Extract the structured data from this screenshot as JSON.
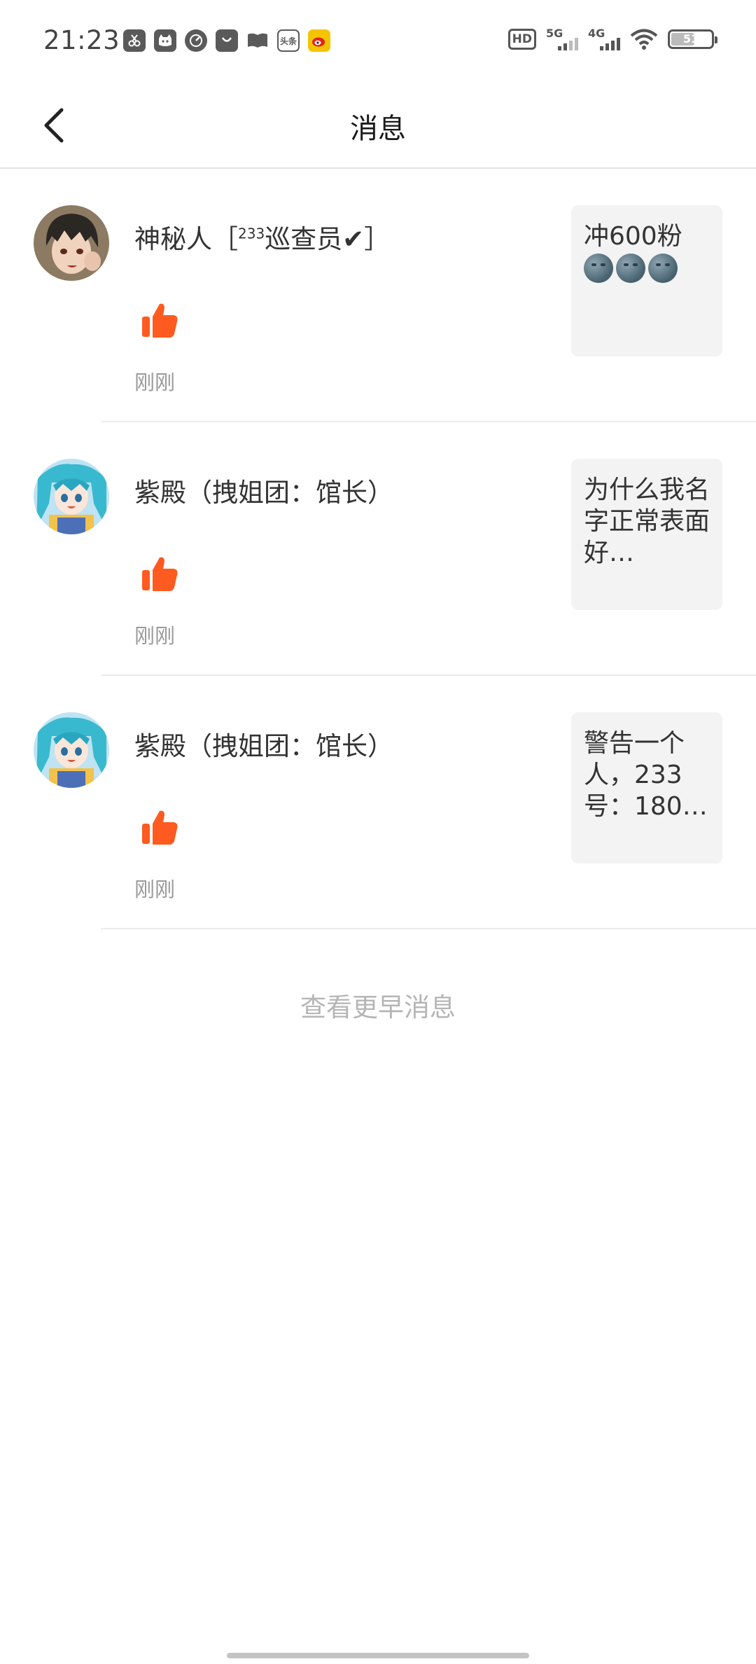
{
  "status_bar": {
    "time": "21:23",
    "notification_icons": [
      "scissors-app-icon",
      "cat-app-icon",
      "speedometer-app-icon",
      "shopping-bag-app-icon",
      "book-app-icon",
      "toutiao-app-icon",
      "weibo-app-icon"
    ],
    "toutiao_label": "头条",
    "hd_label": "HD",
    "sim1_label": "5G",
    "sim2_label": "4G",
    "battery": "51"
  },
  "header": {
    "title": "消息",
    "back_icon": "chevron-left-icon"
  },
  "messages": [
    {
      "name": "神秘人［",
      "name_sup": "233",
      "name_tail": "巡查员✔］",
      "action_icon": "thumbs-up-icon",
      "time": "刚刚",
      "preview_text": "冲600粉",
      "preview_emoji_count": 3
    },
    {
      "name": "紫殿（拽姐团：馆长）",
      "action_icon": "thumbs-up-icon",
      "time": "刚刚",
      "preview_text": "为什么我名字正常表面好…"
    },
    {
      "name": "紫殿（拽姐团：馆长）",
      "action_icon": "thumbs-up-icon",
      "time": "刚刚",
      "preview_text": "警告一个人，233号：180…"
    }
  ],
  "load_more": "查看更早消息",
  "colors": {
    "like": "#ff5a1f",
    "preview_bg": "#f3f3f3",
    "muted_text": "#9a9a9a",
    "load_more_text": "#b5b5b5"
  }
}
